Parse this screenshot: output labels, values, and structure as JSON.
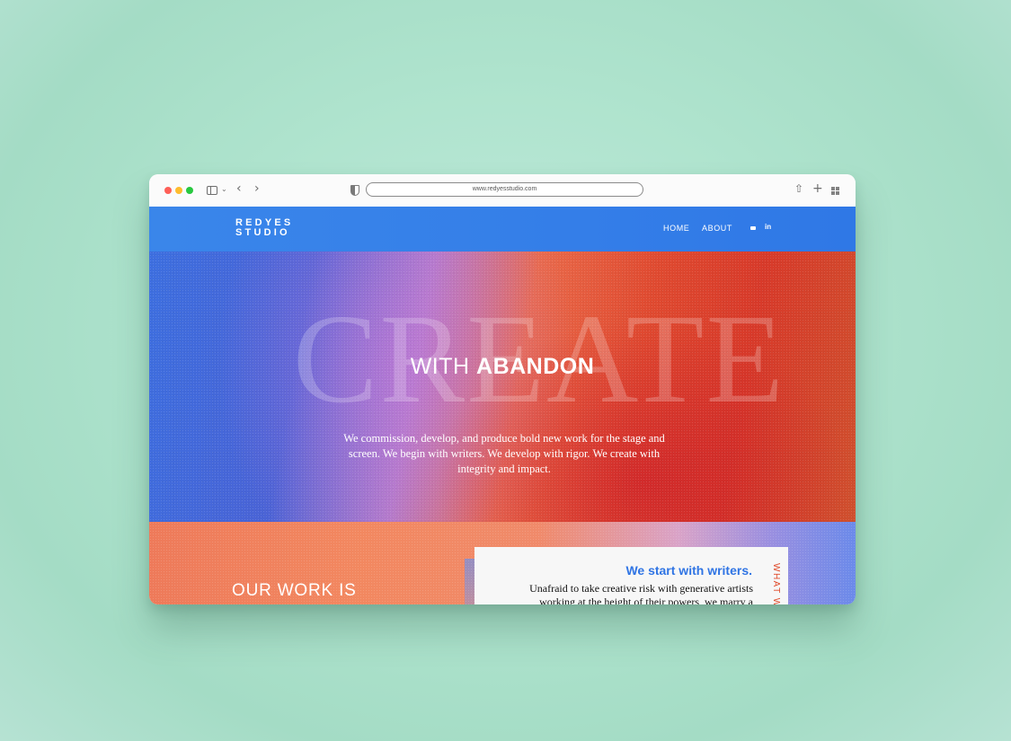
{
  "browser": {
    "url": "www.redyesstudio.com"
  },
  "header": {
    "logo_line1": "REDYES",
    "logo_line2": "STUDIO",
    "nav": [
      {
        "label": "HOME"
      },
      {
        "label": "ABOUT"
      }
    ],
    "social": [
      "mail-icon",
      "linkedin-icon"
    ],
    "linkedin_glyph": "in"
  },
  "hero": {
    "background_word": "CREATE",
    "title_light": "WITH",
    "title_bold": "ABANDON",
    "description": "We commission, develop, and produce bold new work for the stage and screen. We begin with writers. We develop with rigor. We create with integrity and impact."
  },
  "lower": {
    "heading": "OUR WORK IS",
    "card_title": "We start with writers.",
    "card_text": "Unafraid to take creative risk with generative artists working at the height of their powers, we marry a writer-",
    "vertical_label": "WHAT WE"
  },
  "colors": {
    "header_blue": "#347ee8",
    "card_title_blue": "#2f74e4",
    "accent_red": "#e04a2a",
    "background_mint": "#aee3cd"
  }
}
